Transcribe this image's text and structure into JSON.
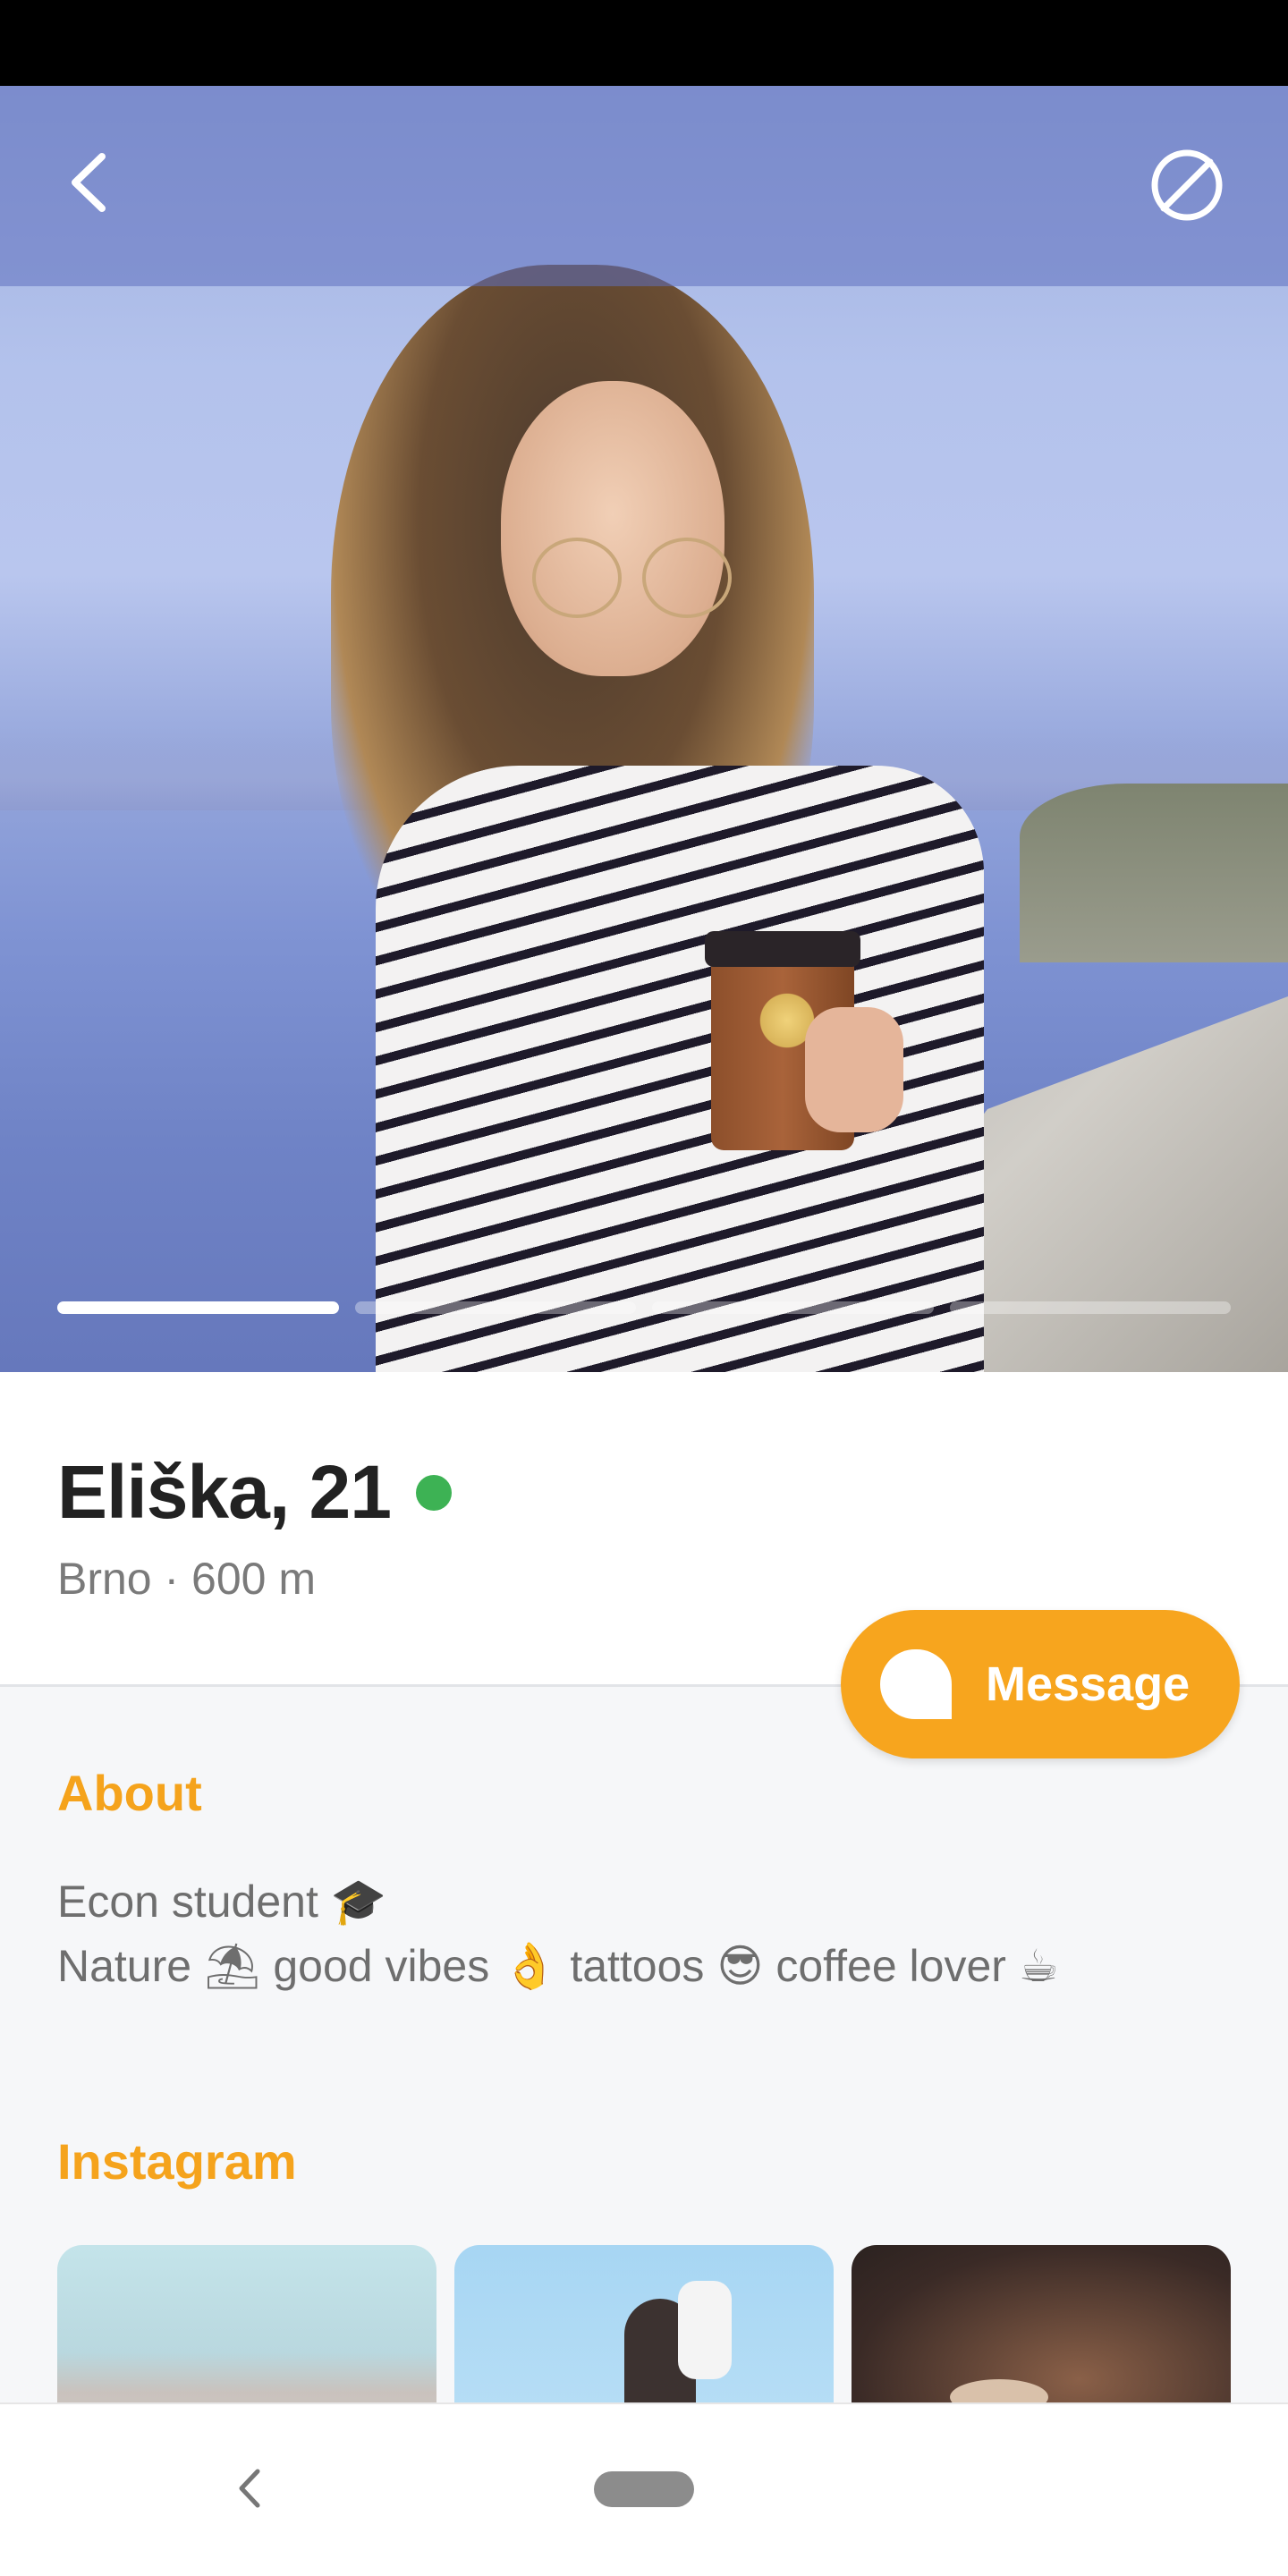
{
  "header": {
    "back_icon": "chevron-left-icon",
    "block_icon": "block-icon"
  },
  "photo": {
    "total_photos": 4,
    "active_index": 0,
    "progress_active_color": "#ffffff"
  },
  "profile": {
    "name_age": "Eliška, 21",
    "online": true,
    "online_color": "#3db254",
    "location": "Brno · 600 m"
  },
  "message_button": {
    "label": "Message",
    "icon": "chat-bubble-icon",
    "color": "#f7a51e"
  },
  "about": {
    "title": "About",
    "line1_text": "Econ student",
    "line1_emoji": "🎓",
    "line2": [
      {
        "text": "Nature",
        "emoji": "⛱"
      },
      {
        "text": "good vibes",
        "emoji": "👌"
      },
      {
        "text": "tattoos",
        "emoji": "😎"
      },
      {
        "text": "coffee lover",
        "emoji": "☕"
      }
    ]
  },
  "instagram": {
    "title": "Instagram"
  },
  "nav_bar": {
    "back_icon": "nav-back-icon",
    "home_icon": "home-pill-icon"
  },
  "accent_color": "#f5a31c"
}
